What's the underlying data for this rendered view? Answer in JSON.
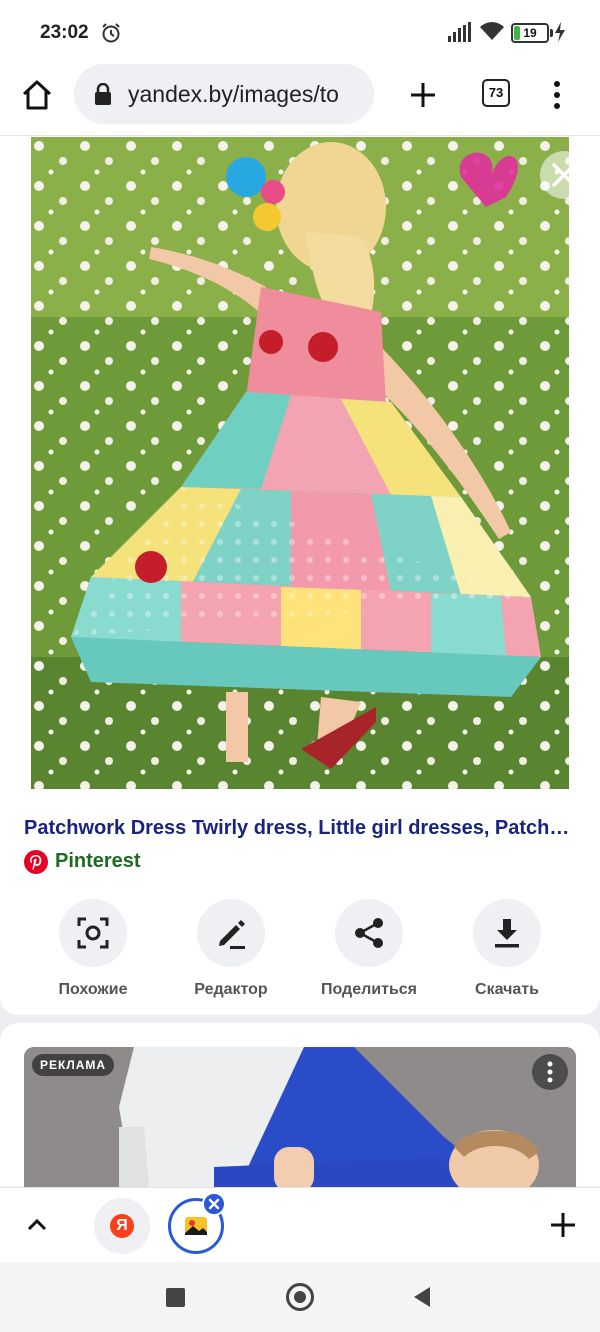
{
  "status_bar": {
    "time": "23:02",
    "battery_percent": "19",
    "battery_level": 0.19,
    "icons": [
      "alarm-icon",
      "signal-icon",
      "wifi-icon",
      "battery-icon",
      "charging-icon"
    ]
  },
  "browser": {
    "url": "yandex.by/images/to",
    "tab_count": "73",
    "icons": [
      "home-icon",
      "lock-icon",
      "plus-icon",
      "tabs-icon",
      "more-vert-icon"
    ]
  },
  "image_viewer": {
    "title": "Patchwork Dress Twirly dress, Little girl dresses, Patchwork dress pattern",
    "source_name": "Pinterest",
    "source_icon": "pinterest-icon",
    "close_icon": "close-icon",
    "actions": [
      {
        "label": "Похожие",
        "icon": "similar-search-icon"
      },
      {
        "label": "Редактор",
        "icon": "pencil-icon"
      },
      {
        "label": "Поделиться",
        "icon": "share-icon"
      },
      {
        "label": "Скачать",
        "icon": "download-icon"
      }
    ]
  },
  "ad": {
    "badge": "РЕКЛАМА",
    "menu_icon": "more-vert-icon"
  },
  "bottom_bar": {
    "icons": [
      "chevron-up-icon",
      "yandex-icon",
      "images-icon",
      "plus-icon"
    ],
    "yandex_letter": "Я"
  },
  "colors": {
    "title": "#1a237e",
    "source": "#1d6b22",
    "pinterest": "#e60023",
    "accent": "#2a58d6",
    "yandex": "#fc3f1d"
  }
}
